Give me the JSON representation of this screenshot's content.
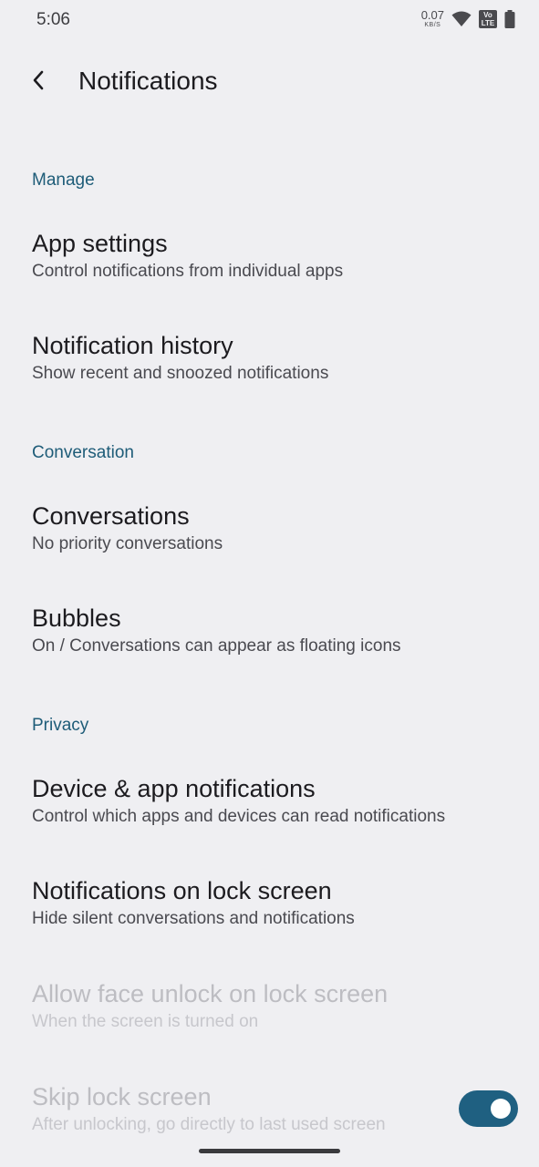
{
  "status_bar": {
    "time": "5:06",
    "net_speed_value": "0.07",
    "net_speed_unit": "KB/S",
    "volte_label_top": "Vo",
    "volte_label_bottom": "LTE"
  },
  "app_bar": {
    "title": "Notifications"
  },
  "sections": {
    "manage": "Manage",
    "conversation": "Conversation",
    "privacy": "Privacy"
  },
  "items": {
    "app_settings": {
      "title": "App settings",
      "summary": "Control notifications from individual apps"
    },
    "notification_history": {
      "title": "Notification history",
      "summary": "Show recent and snoozed notifications"
    },
    "conversations": {
      "title": "Conversations",
      "summary": "No priority conversations"
    },
    "bubbles": {
      "title": "Bubbles",
      "summary": "On / Conversations can appear as floating icons"
    },
    "device_app_notifications": {
      "title": "Device & app notifications",
      "summary": "Control which apps and devices can read notifications"
    },
    "lock_screen_notifications": {
      "title": "Notifications on lock screen",
      "summary": "Hide silent conversations and notifications"
    },
    "face_unlock": {
      "title": "Allow face unlock on lock screen",
      "summary": "When the screen is turned on"
    },
    "skip_lock_screen": {
      "title": "Skip lock screen",
      "summary": "After unlocking, go directly to last used screen",
      "toggle_on": true
    }
  },
  "colors": {
    "background": "#efeff2",
    "accent": "#1e5c78",
    "toggle_track": "#1f6081"
  }
}
